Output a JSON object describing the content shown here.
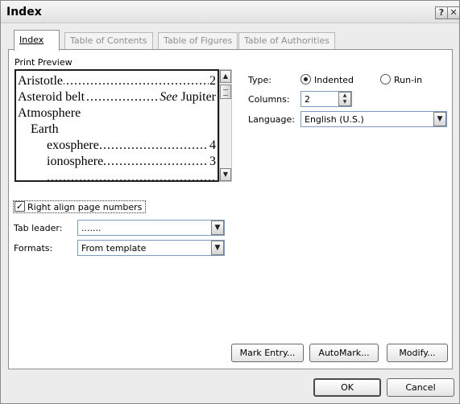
{
  "window": {
    "title": "Index",
    "help_icon": "?",
    "close_icon": "✕"
  },
  "tabs": [
    {
      "label": "Index",
      "active": true
    },
    {
      "label": "Table of Contents",
      "active": false
    },
    {
      "label": "Table of Figures",
      "active": false
    },
    {
      "label": "Table of Authorities",
      "active": false
    }
  ],
  "preview": {
    "label": "Print Preview",
    "lines": [
      {
        "text": "Aristotle",
        "page": "2",
        "indent": 0
      },
      {
        "text": "Asteroid belt",
        "see": "See",
        "ref": "Jupiter",
        "indent": 0
      },
      {
        "text": "Atmosphere",
        "page": "",
        "indent": 0
      },
      {
        "text": "Earth",
        "page": "",
        "indent": 1
      },
      {
        "text": "exosphere",
        "page": "4",
        "indent": 2
      },
      {
        "text": "ionosphere",
        "page": "3",
        "indent": 2
      }
    ]
  },
  "type": {
    "label": "Type:",
    "options": [
      {
        "label": "Indented",
        "checked": true
      },
      {
        "label": "Run-in",
        "checked": false
      }
    ]
  },
  "columns": {
    "label": "Columns:",
    "value": "2"
  },
  "language": {
    "label": "Language:",
    "value": "English (U.S.)"
  },
  "right_align": {
    "label": "Right align page numbers",
    "checked": true
  },
  "tab_leader": {
    "label": "Tab leader:",
    "value": "......."
  },
  "formats": {
    "label": "Formats:",
    "value": "From template"
  },
  "buttons": {
    "mark_entry": "Mark Entry...",
    "automark": "AutoMark...",
    "modify": "Modify...",
    "ok": "OK",
    "cancel": "Cancel"
  },
  "colors": {
    "dialog_bg": "#ececec",
    "panel_bg": "#ffffff",
    "field_border": "#7f9db9"
  }
}
